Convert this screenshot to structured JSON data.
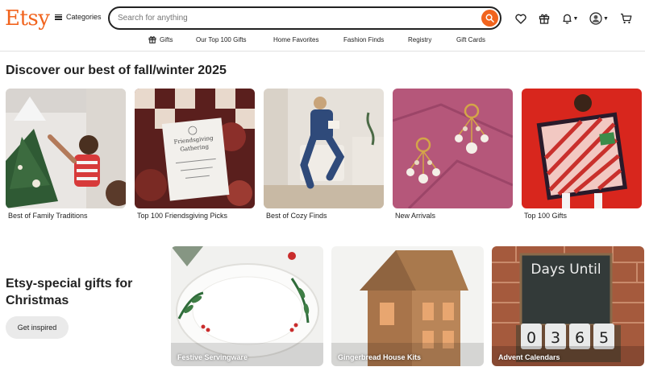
{
  "header": {
    "logo": "Etsy",
    "categories_label": "Categories",
    "search_placeholder": "Search for anything",
    "accent_color": "#f1641e"
  },
  "subnav": [
    {
      "label": "Gifts",
      "icon": "gift-icon"
    },
    {
      "label": "Our Top 100 Gifts"
    },
    {
      "label": "Home Favorites"
    },
    {
      "label": "Fashion Finds"
    },
    {
      "label": "Registry"
    },
    {
      "label": "Gift Cards"
    }
  ],
  "discover": {
    "title": "Discover our best of fall/winter 2025",
    "cards": [
      {
        "label": "Best of Family Traditions"
      },
      {
        "label": "Top 100 Friendsgiving Picks"
      },
      {
        "label": "Best of Cozy Finds"
      },
      {
        "label": "New Arrivals"
      },
      {
        "label": "Top 100 Gifts"
      }
    ]
  },
  "christmas": {
    "title": "Etsy-special gifts for Christmas",
    "button": "Get inspired",
    "cards": [
      {
        "label": "Festive Servingware"
      },
      {
        "label": "Gingerbread House Kits"
      },
      {
        "label": "Advent Calendars",
        "board_text": "Days Until",
        "digits": [
          "0",
          "3",
          "6",
          "5"
        ]
      }
    ]
  },
  "card2_text": {
    "line1": "Friendsgiving",
    "line2": "Gathering"
  }
}
